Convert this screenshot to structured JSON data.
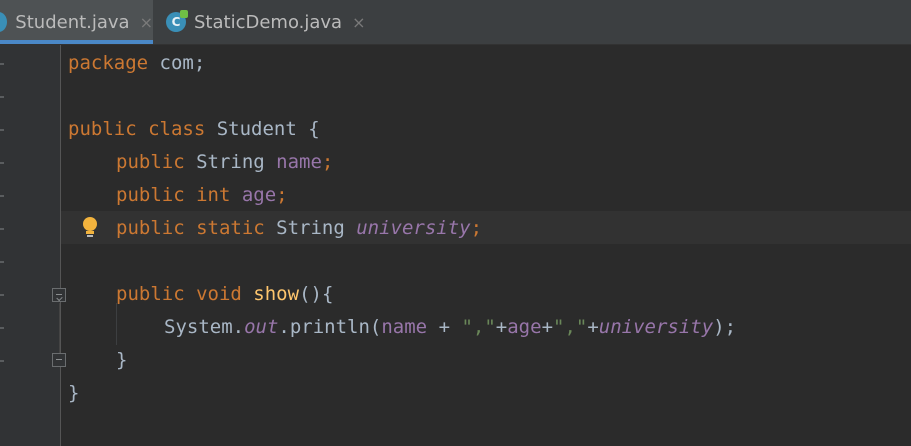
{
  "tabs": [
    {
      "label": "Student.java",
      "active": true,
      "close": "×"
    },
    {
      "label": "StaticDemo.java",
      "active": false,
      "close": "×"
    }
  ],
  "code": {
    "line1": {
      "kw": "package",
      "rest": " com;"
    },
    "line3": {
      "kw": "public class",
      "rest": " Student {"
    },
    "line4": {
      "kw": "public",
      "type": " String ",
      "field": "name",
      "end": ";"
    },
    "line5": {
      "kw": "public int",
      "sp": " ",
      "field": "age",
      "end": ";"
    },
    "line6": {
      "kw": "public static",
      "type": " String ",
      "field": "university",
      "end": ";"
    },
    "line8": {
      "kw": "public void",
      "sp": " ",
      "fn": "show",
      "end": "(){"
    },
    "line9": {
      "a": "System.",
      "out": "out",
      "b": ".println(",
      "name": "name",
      "c": " + ",
      "s1": "\",\"",
      "d": "+",
      "age": "age",
      "e": "+",
      "s2": "\",\"",
      "f": "+",
      "univ": "university",
      "g": ");"
    },
    "line10": "}",
    "line11": "}"
  },
  "colors": {
    "keyword": "#cc7832",
    "field": "#9876aa",
    "method": "#ffc66d",
    "string": "#6a8759",
    "text": "#a9b7c6",
    "background": "#2b2b2b"
  },
  "icons": [
    "java-class-icon",
    "lightbulb-icon",
    "fold-icon"
  ]
}
